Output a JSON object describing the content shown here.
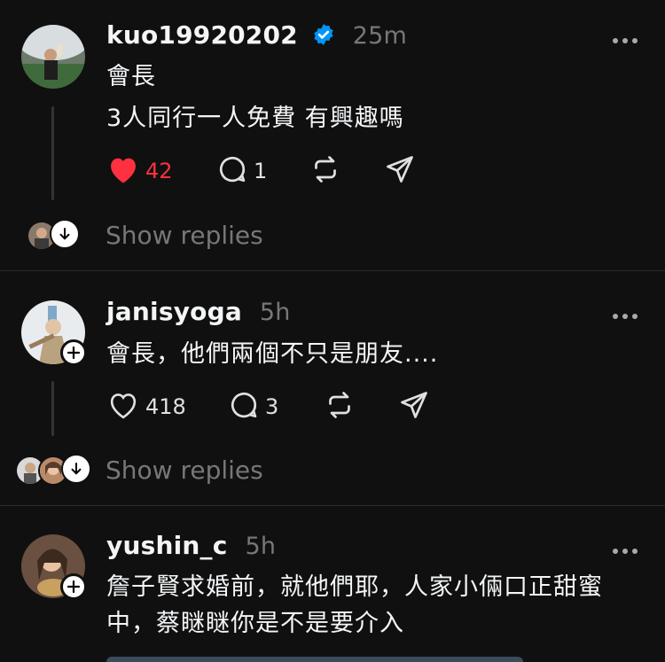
{
  "posts": [
    {
      "username": "kuo19920202",
      "verified": true,
      "time": "25m",
      "lines": [
        "會長",
        "3人同行一人免費 有興趣嗎"
      ],
      "likes": "42",
      "liked": true,
      "replies": "1",
      "show_replies": "Show replies"
    },
    {
      "username": "janisyoga",
      "verified": false,
      "time": "5h",
      "lines": [
        "會長，他們兩個不只是朋友...."
      ],
      "likes": "418",
      "liked": false,
      "replies": "3",
      "show_replies": "Show replies"
    },
    {
      "username": "yushin_c",
      "verified": false,
      "time": "5h",
      "lines": [
        "詹子賢求婚前，就他們耶，人家小倆口正甜蜜",
        "中，蔡瞇瞇你是不是要介入"
      ]
    }
  ],
  "colors": {
    "background": "#101010",
    "like_red": "#ff3040",
    "verified_blue": "#0095f6",
    "muted": "#777777"
  },
  "icons": [
    "heart-icon",
    "comment-icon",
    "repost-icon",
    "share-icon",
    "more-icon",
    "verified-icon",
    "follow-plus-icon",
    "expand-arrow-icon"
  ]
}
